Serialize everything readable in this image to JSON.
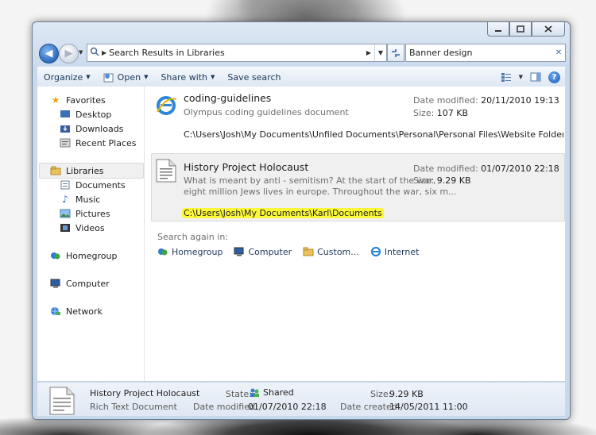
{
  "window": {
    "address_text": "Search Results in Libraries",
    "search_value": "Banner design"
  },
  "toolbar": {
    "organize": "Organize",
    "open": "Open",
    "share_with": "Share with",
    "save_search": "Save search"
  },
  "sidebar": {
    "favorites": "Favorites",
    "desktop": "Desktop",
    "downloads": "Downloads",
    "recent_places": "Recent Places",
    "libraries": "Libraries",
    "documents": "Documents",
    "music": "Music",
    "pictures": "Pictures",
    "videos": "Videos",
    "homegroup": "Homegroup",
    "computer": "Computer",
    "network": "Network"
  },
  "results": [
    {
      "name": "coding-guidelines",
      "summary": "Olympus coding guidelines document",
      "date_label": "Date modified:",
      "date": "20/11/2010 19:13",
      "size_label": "Size:",
      "size": "107 KB",
      "path": "C:\\Users\\Josh\\My Documents\\Unfiled Documents\\Personal\\Personal Files\\Website Folder\\Installation\\..."
    },
    {
      "name": "History Project Holocaust",
      "summary_line1": "What is meant by anti - semitism? At the start of the war,",
      "summary_line2": "eight million Jews lives in europe. Throughout the war, six m...",
      "date_label": "Date modified:",
      "date": "01/07/2010 22:18",
      "size_label": "Size:",
      "size": "9.29 KB",
      "path": "C:\\Users\\Josh\\My Documents\\Karl\\Documents"
    }
  ],
  "search_again": {
    "label": "Search again in:",
    "homegroup": "Homegroup",
    "computer": "Computer",
    "custom": "Custom...",
    "internet": "Internet"
  },
  "details": {
    "name": "History Project Holocaust",
    "type": "Rich Text Document",
    "state_label": "State:",
    "state": "Shared",
    "date_modified_label": "Date modified:",
    "date_modified": "01/07/2010 22:18",
    "size_label": "Size:",
    "size": "9.29 KB",
    "date_created_label": "Date created:",
    "date_created": "14/05/2011 11:00"
  },
  "colors": {
    "highlight": "#fbf83a",
    "accent_blue": "#1e395b"
  }
}
